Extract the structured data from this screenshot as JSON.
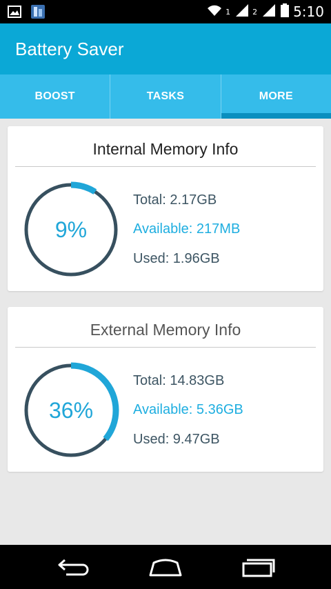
{
  "status_bar": {
    "sim1": "1",
    "sim2": "2",
    "time": "5:10"
  },
  "app": {
    "title": "Battery Saver"
  },
  "tabs": [
    {
      "label": "BOOST",
      "active": false
    },
    {
      "label": "TASKS",
      "active": false
    },
    {
      "label": "MORE",
      "active": true
    }
  ],
  "internal": {
    "title": "Internal Memory Info",
    "percent_label": "9%",
    "used_fraction": 0.09,
    "total": "Total: 2.17GB",
    "available": "Available: 217MB",
    "used": "Used: 1.96GB"
  },
  "external": {
    "title": "External Memory Info",
    "percent_label": "36%",
    "used_fraction": 0.36,
    "total": "Total: 14.83GB",
    "available": "Available: 5.36GB",
    "used": "Used: 9.47GB"
  },
  "colors": {
    "app_bar": "#0ba8d6",
    "tab_bar": "#35bcea",
    "tab_indicator": "#0a8fbf",
    "ring_track": "#37505f",
    "ring_progress": "#20a6d8"
  },
  "icons": {
    "status_left": [
      "image-icon",
      "app-notification-icon"
    ],
    "status_right": [
      "wifi-icon",
      "signal-icon",
      "battery-icon"
    ],
    "nav": [
      "back-icon",
      "home-icon",
      "recent-apps-icon"
    ]
  }
}
